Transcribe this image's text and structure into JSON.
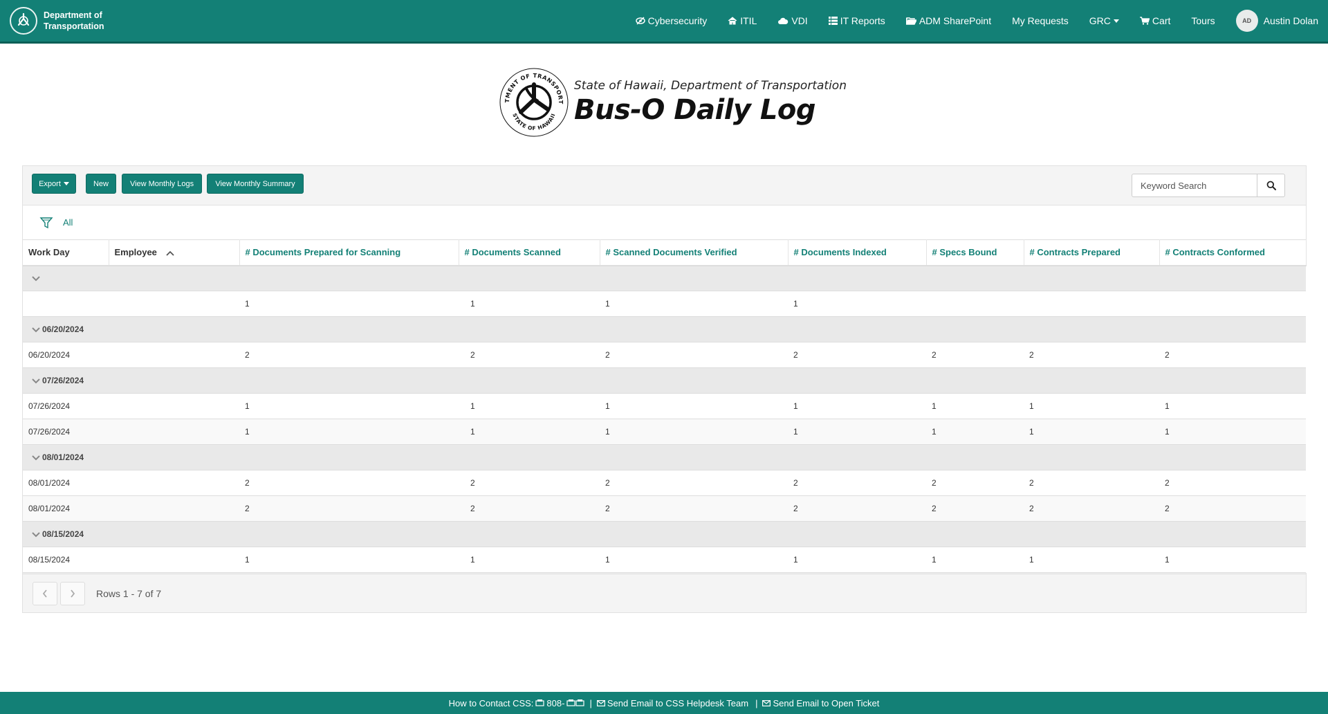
{
  "nav": {
    "brand_line1": "Department of",
    "brand_line2": "Transportation",
    "items": [
      {
        "label": "Cybersecurity",
        "icon": "eye-slash-icon"
      },
      {
        "label": "ITIL",
        "icon": "home-icon"
      },
      {
        "label": "VDI",
        "icon": "cloud-icon"
      },
      {
        "label": "IT Reports",
        "icon": "list-icon"
      },
      {
        "label": "ADM SharePoint",
        "icon": "folder-open-icon"
      },
      {
        "label": "My Requests",
        "icon": ""
      },
      {
        "label": "GRC",
        "icon": "caret-down-icon"
      },
      {
        "label": "Cart",
        "icon": "cart-icon"
      },
      {
        "label": "Tours",
        "icon": ""
      }
    ],
    "user_initials": "AD",
    "user_name": "Austin Dolan"
  },
  "banner": {
    "subtitle": "State of Hawaii, Department of Transportation",
    "title": "Bus-O Daily Log",
    "seal_text_top": "DEPARTMENT OF TRANSPORTATION",
    "seal_text_bottom": "STATE OF HAWAII"
  },
  "toolbar": {
    "export": "Export",
    "new": "New",
    "view_monthly_logs": "View Monthly Logs",
    "view_monthly_summary": "View Monthly Summary",
    "search_placeholder": "Keyword Search"
  },
  "filter": {
    "label": "All"
  },
  "table": {
    "columns": [
      "Work Day",
      "Employee",
      "# Documents Prepared for Scanning",
      "# Documents Scanned",
      "# Scanned Documents Verified",
      "# Documents Indexed",
      "# Specs Bound",
      "# Contracts Prepared",
      "# Contracts Conformed"
    ],
    "sorted_column": "Employee",
    "sort_direction": "ascending",
    "groups": [
      {
        "label": "",
        "rows": [
          [
            "",
            "",
            "1",
            "1",
            "1",
            "1",
            "",
            "",
            ""
          ]
        ]
      },
      {
        "label": "06/20/2024",
        "rows": [
          [
            "06/20/2024",
            "",
            "2",
            "2",
            "2",
            "2",
            "2",
            "2",
            "2"
          ]
        ]
      },
      {
        "label": "07/26/2024",
        "rows": [
          [
            "07/26/2024",
            "",
            "1",
            "1",
            "1",
            "1",
            "1",
            "1",
            "1"
          ],
          [
            "07/26/2024",
            "",
            "1",
            "1",
            "1",
            "1",
            "1",
            "1",
            "1"
          ]
        ]
      },
      {
        "label": "08/01/2024",
        "rows": [
          [
            "08/01/2024",
            "",
            "2",
            "2",
            "2",
            "2",
            "2",
            "2",
            "2"
          ],
          [
            "08/01/2024",
            "",
            "2",
            "2",
            "2",
            "2",
            "2",
            "2",
            "2"
          ]
        ]
      },
      {
        "label": "08/15/2024",
        "rows": [
          [
            "08/15/2024",
            "",
            "1",
            "1",
            "1",
            "1",
            "1",
            "1",
            "1"
          ]
        ]
      }
    ]
  },
  "pager": {
    "text": "Rows 1 - 7 of 7"
  },
  "footer": {
    "contact_label": "How to Contact CSS:",
    "phone": "808-",
    "email_team": "Send Email to CSS Helpdesk Team",
    "email_ticket": "Send Email to Open Ticket"
  },
  "colors": {
    "brand": "#138076",
    "brand_dark": "#0c5f57",
    "group_row": "#e9e9e9",
    "panel_bg": "#f4f4f4"
  }
}
